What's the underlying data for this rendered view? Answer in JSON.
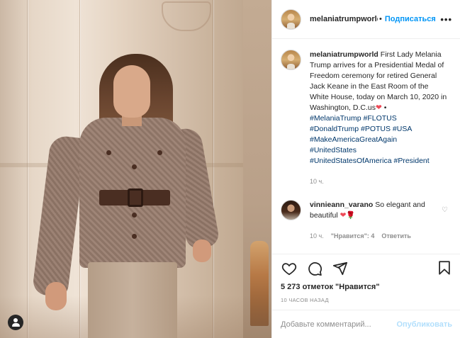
{
  "post": {
    "username": "melaniatrumpworld",
    "header_username": "melaniatrumpworld",
    "follow_label": "Подписаться",
    "caption_username": "melaniatrumpworld",
    "caption_text": "First Lady Melania Trump arrives for a Presidential Medal of Freedom ceremony for retired General Jack Keane in the East Room of the White House, today on March 10, 2020 in Washington, D.C.us",
    "caption_heart": "❤",
    "caption_bullet": "•",
    "hashtags": [
      "#MelaniaTrump",
      "#FLOTUS",
      "#DonaldTrump",
      "#POTUS",
      "#USA",
      "#MakeAmericaGreatAgain",
      "#UnitedStates",
      "#UnitedStatesOfAmerica",
      "#President"
    ],
    "caption_time": "10 ч."
  },
  "comment": {
    "username": "vinnieann_varano",
    "text": "So elegant and beautiful",
    "emoji": "❤🌹",
    "time": "10 ч.",
    "likes": "\"Нравится\": 4",
    "reply": "Ответить"
  },
  "footer": {
    "likes": "5 273 отметок \"Нравится\"",
    "timestamp": "10 ЧАСОВ НАЗАД",
    "comment_placeholder": "Добавьте комментарий...",
    "publish_label": "Опубликовать"
  },
  "icons": {
    "more": "more-options-icon",
    "like": "heart-icon",
    "comment": "comment-icon",
    "share": "share-icon",
    "save": "bookmark-icon",
    "tag": "user-tag-icon"
  }
}
